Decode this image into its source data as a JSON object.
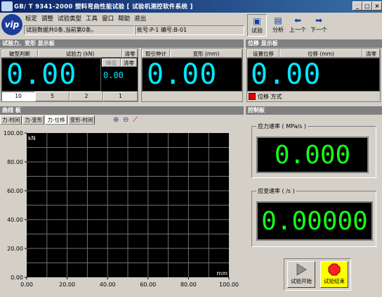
{
  "window": {
    "title": "GB/ T 9341-2000  塑料弯曲性能试验   [ 试验机测控软件系统 ]",
    "controls": [
      "_",
      "□",
      "×"
    ]
  },
  "logo_text": "vip",
  "menu": [
    "标定",
    "调整",
    "试验类型",
    "工具",
    "窗口",
    "帮助",
    "退出"
  ],
  "info": {
    "status": "试验数据共0条,当前第0条。",
    "batch": "批号:P-1  编号:B-01"
  },
  "toolbar": [
    {
      "label": "试验",
      "icon": "test-icon"
    },
    {
      "label": "分析",
      "icon": "analysis-icon"
    },
    {
      "label": "上一个",
      "icon": "arrow-left-icon"
    },
    {
      "label": "下一个",
      "icon": "arrow-right-icon"
    }
  ],
  "force_panel": {
    "title": "试验力、变形  显示板",
    "col_break": "破型判断",
    "col_force": "试验力 (kN)",
    "clear": "清零",
    "force_value": "0.00",
    "peak_label": "峰值",
    "peak_clear": "清零",
    "peak_value": "0.00",
    "ranges": [
      "10",
      "5",
      "2",
      "1"
    ],
    "col_extens": "取引伸计",
    "col_deform": "变形 (mm)",
    "deform_value": "0.00"
  },
  "disp_panel": {
    "title": "位移  显示板",
    "col_set": "设置位移",
    "col_disp": "位移 (mm)",
    "clear": "清零",
    "disp_value": "0.00",
    "mode_label": "位移  方式"
  },
  "curve_panel": {
    "title": "曲线  板",
    "tabs": [
      "力-时间",
      "力-变形",
      "力-位移",
      "变形-时间"
    ],
    "active_tab": 2,
    "zoom_in_icon": "zoom-in-icon",
    "zoom_out_icon": "zoom-out-icon",
    "curve_icon": "curve-icon"
  },
  "chart_data": {
    "type": "line",
    "ylabel": "kN",
    "xlabel": "mm",
    "xlim": [
      0,
      100
    ],
    "ylim": [
      0,
      100
    ],
    "x_ticks": [
      "0.00",
      "20.00",
      "40.00",
      "60.00",
      "80.00",
      "100.00"
    ],
    "y_ticks": [
      "100.00",
      "80.00",
      "60.00",
      "40.00",
      "20.00",
      "0.00"
    ],
    "grid": true,
    "series": []
  },
  "control_panel": {
    "title": "控制板",
    "stress_rate_label": "应力速率 ( MPa/s )",
    "stress_rate_value": "0.000",
    "strain_rate_label": "应变速率 ( /s )",
    "strain_rate_value": "0.00000",
    "start_label": "试验开始",
    "end_label": "试验结束"
  },
  "colors": {
    "title_bar": "#0a246a",
    "lcd_cyan": "#00e8ff",
    "lcd_green": "#18ff18",
    "panel_header": "#808080",
    "stop_red": "#ff2020",
    "mode_indicator": "#e00000"
  }
}
